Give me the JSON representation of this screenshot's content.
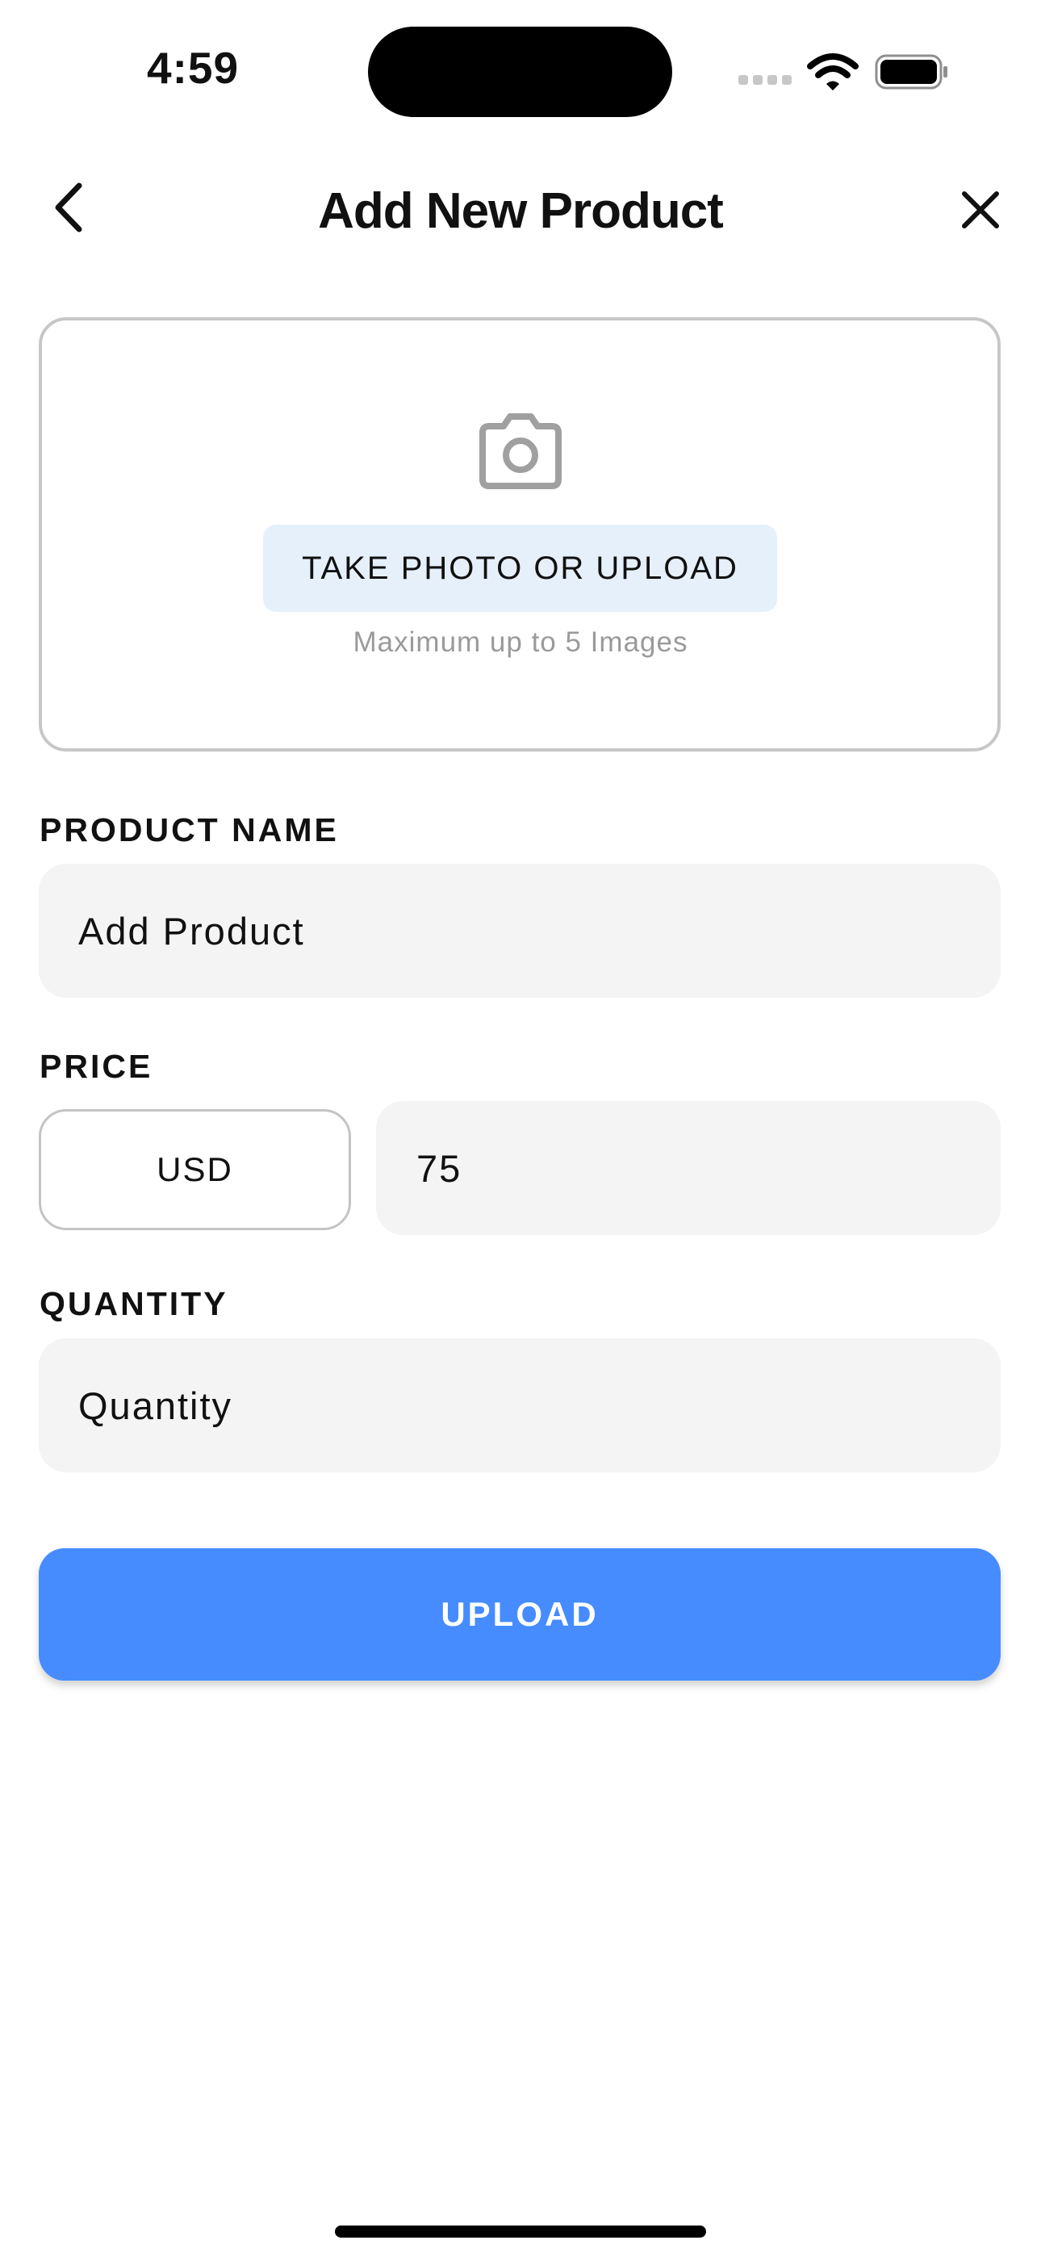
{
  "status_bar": {
    "time": "4:59"
  },
  "nav": {
    "title": "Add New Product",
    "back_icon": "chevron-left-icon",
    "close_icon": "close-icon"
  },
  "photo_upload": {
    "icon": "camera-icon",
    "button_label": "TAKE PHOTO OR UPLOAD",
    "hint": "Maximum up to 5 Images"
  },
  "form": {
    "product_name": {
      "label": "PRODUCT NAME",
      "placeholder": "Add Product"
    },
    "price": {
      "label": "PRICE",
      "currency": "USD",
      "value": "75"
    },
    "quantity": {
      "label": "QUANTITY",
      "placeholder": "Quantity"
    }
  },
  "actions": {
    "upload_label": "UPLOAD"
  },
  "colors": {
    "primary": "#468cff",
    "upload_chip_bg": "#e6f0fb",
    "input_bg": "#f4f4f4",
    "border": "#c7c7c7"
  }
}
